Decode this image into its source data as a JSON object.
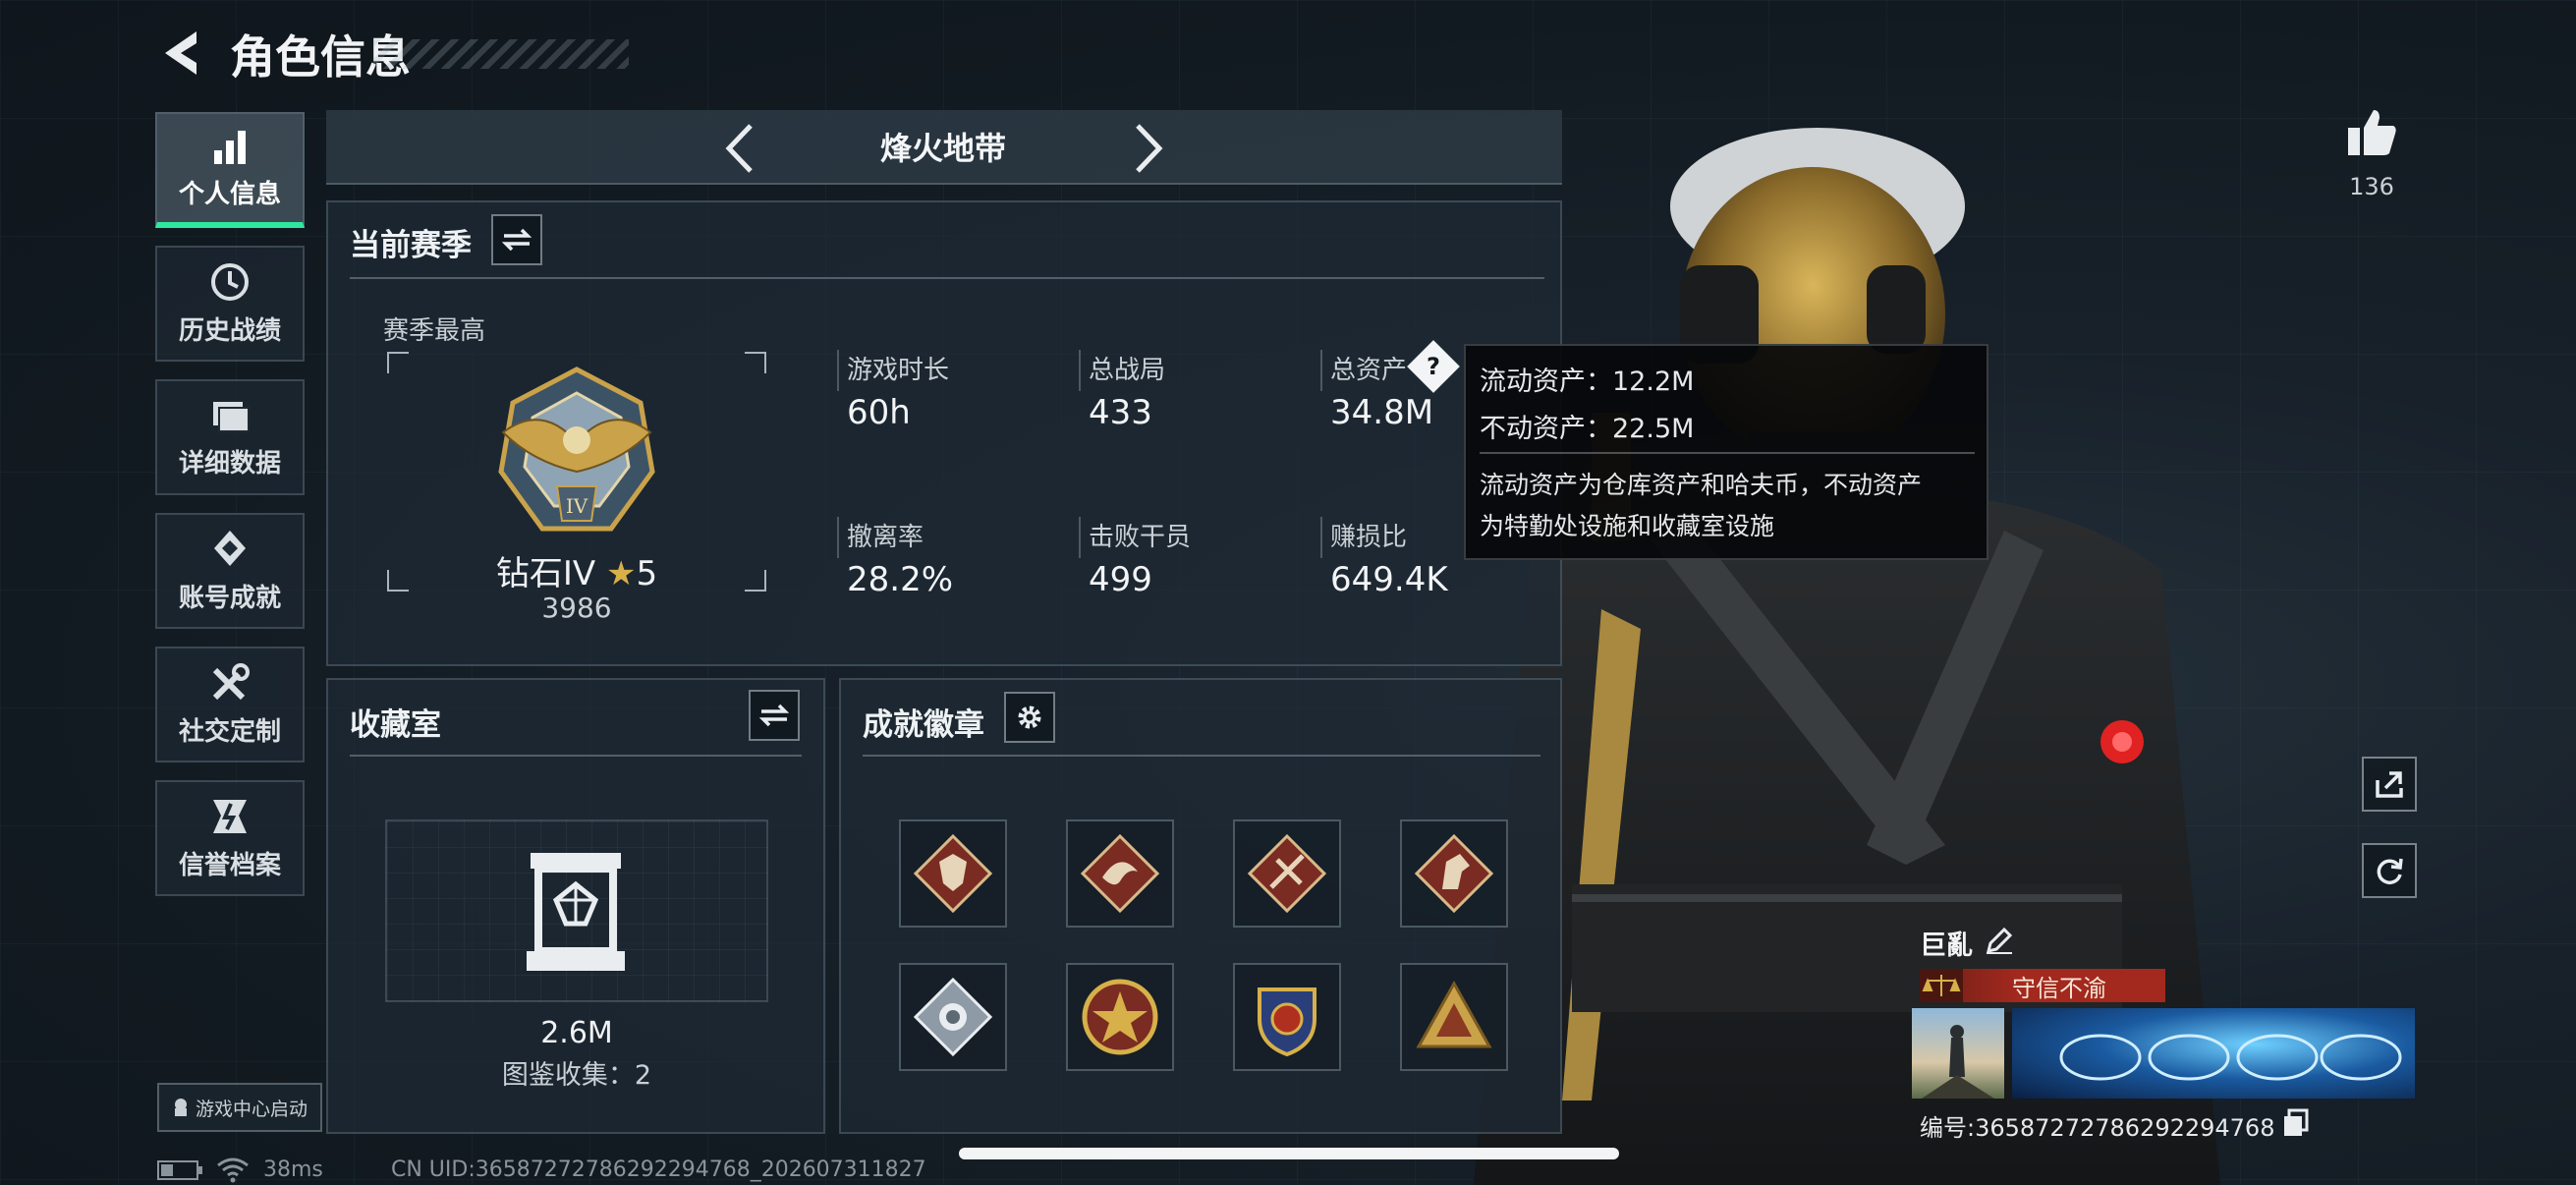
{
  "header": {
    "title": "角色信息"
  },
  "nav": {
    "items": [
      {
        "label": "个人信息",
        "icon": "bar-chart-icon",
        "active": true
      },
      {
        "label": "历史战绩",
        "icon": "history-clock-icon"
      },
      {
        "label": "详细数据",
        "icon": "folder-icon"
      },
      {
        "label": "账号成就",
        "icon": "achievement-icon"
      },
      {
        "label": "社交定制",
        "icon": "tools-icon"
      },
      {
        "label": "信誉档案",
        "icon": "reputation-icon"
      }
    ],
    "game_center": "游戏中心启动"
  },
  "mode_selector": {
    "label": "烽火地带"
  },
  "season": {
    "title": "当前赛季",
    "best_label": "赛季最高",
    "rank": {
      "name": "钻石IV",
      "stars": "5",
      "score": "3986",
      "emblem_text": "IV"
    },
    "stats": [
      {
        "label": "游戏时长",
        "value": "60h"
      },
      {
        "label": "总战局",
        "value": "433"
      },
      {
        "label": "总资产",
        "value": "34.8M"
      },
      {
        "label": "撤离率",
        "value": "28.2%"
      },
      {
        "label": "击败干员",
        "value": "499"
      },
      {
        "label": "赚损比",
        "value": "649.4K"
      }
    ]
  },
  "tooltip": {
    "liquid": "流动资产：12.2M",
    "fixed": "不动资产：22.5M",
    "desc_line1": "流动资产为仓库资产和哈夫币，不动资产",
    "desc_line2": "为特勤处设施和收藏室设施"
  },
  "collection": {
    "title": "收藏室",
    "value": "2.6M",
    "count": "图鉴收集：2"
  },
  "achievements": {
    "title": "成就徽章",
    "badges": [
      "wolf-badge-icon",
      "dragon-badge-icon",
      "blade-badge-icon",
      "horse-badge-icon",
      "silver-gem-badge-icon",
      "star-medal-badge-icon",
      "shield-crest-badge-icon",
      "gold-pyramid-badge-icon"
    ]
  },
  "right": {
    "likes": "136",
    "player_name": "巨亂",
    "title_badge": "守信不渝",
    "serial": "编号:3658727278629229476​8"
  },
  "status_bar": {
    "ping": "38ms",
    "uid": "CN UID:3658727278629229476​8_202607311827"
  },
  "colors": {
    "accent": "#2ee8a0",
    "title_badge_bg": "#a3281e",
    "gold": "#c9a24a"
  }
}
